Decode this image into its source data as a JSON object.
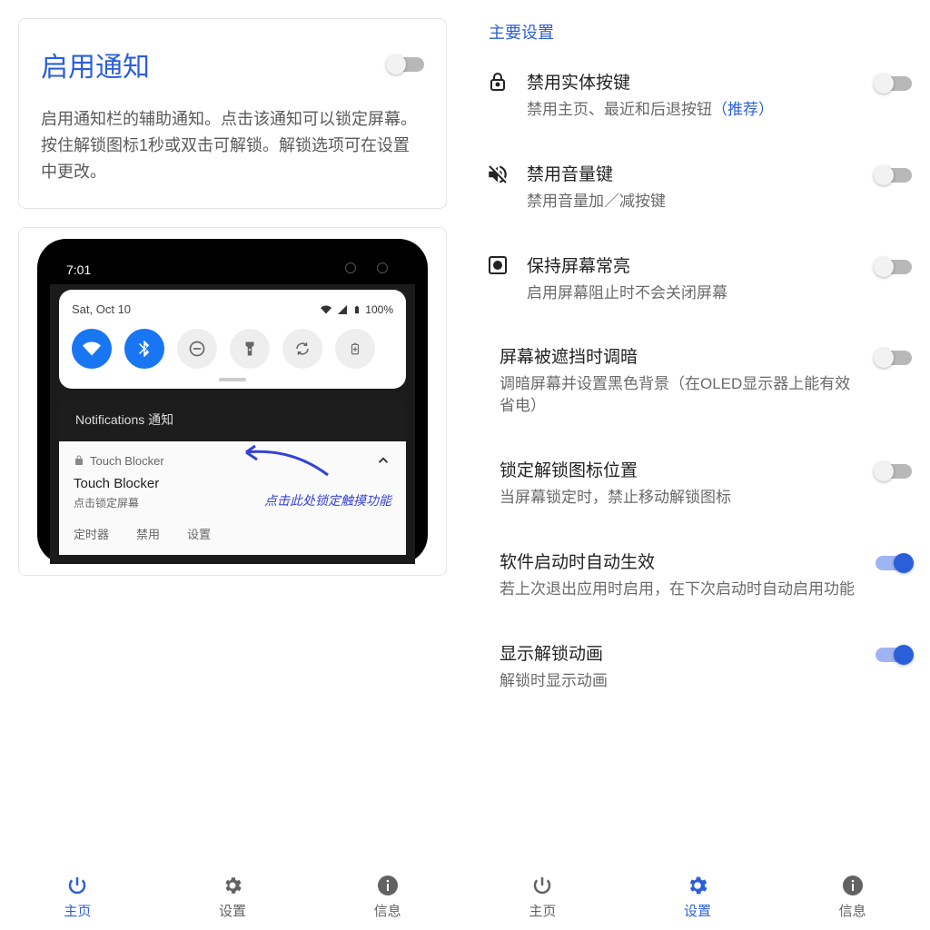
{
  "left": {
    "card_title": "启用通知",
    "card_desc": "启用通知栏的辅助通知。点击该通知可以锁定屏幕。按住解锁图标1秒或双击可解锁。解锁选项可在设置中更改。",
    "phone": {
      "time": "7:01",
      "date": "Sat, Oct 10",
      "battery": "100%",
      "notif_header": "Notifications 通知",
      "notif_app": "Touch Blocker",
      "notif_title": "Touch Blocker",
      "notif_sub": "点击锁定屏幕",
      "notif_actions": [
        "定时器",
        "禁用",
        "设置"
      ],
      "annotation": "点击此处锁定触摸功能"
    },
    "nav": [
      {
        "label": "主页",
        "icon": "power",
        "active": true
      },
      {
        "label": "设置",
        "icon": "gear",
        "active": false
      },
      {
        "label": "信息",
        "icon": "info",
        "active": false
      }
    ]
  },
  "right": {
    "section_title": "主要设置",
    "settings": [
      {
        "title": "禁用实体按键",
        "desc_pre": "禁用主页、最近和后退按钮",
        "rec": "（推荐）",
        "icon": "lock",
        "on": false
      },
      {
        "title": "禁用音量键",
        "desc": "禁用音量加／减按键",
        "icon": "volume-off",
        "on": false
      },
      {
        "title": "保持屏幕常亮",
        "desc": "启用屏幕阻止时不会关闭屏幕",
        "icon": "brightness",
        "on": false
      },
      {
        "title": "屏幕被遮挡时调暗",
        "desc": "调暗屏幕并设置黑色背景（在OLED显示器上能有效省电）",
        "icon": "",
        "on": false
      },
      {
        "title": "锁定解锁图标位置",
        "desc": "当屏幕锁定时，禁止移动解锁图标",
        "icon": "",
        "on": false
      },
      {
        "title": "软件启动时自动生效",
        "desc": "若上次退出应用时启用，在下次启动时自动启用功能",
        "icon": "",
        "on": true
      },
      {
        "title": "显示解锁动画",
        "desc": "解锁时显示动画",
        "icon": "",
        "on": true
      }
    ],
    "nav": [
      {
        "label": "主页",
        "icon": "power",
        "active": false
      },
      {
        "label": "设置",
        "icon": "gear",
        "active": true
      },
      {
        "label": "信息",
        "icon": "info",
        "active": false
      }
    ]
  }
}
